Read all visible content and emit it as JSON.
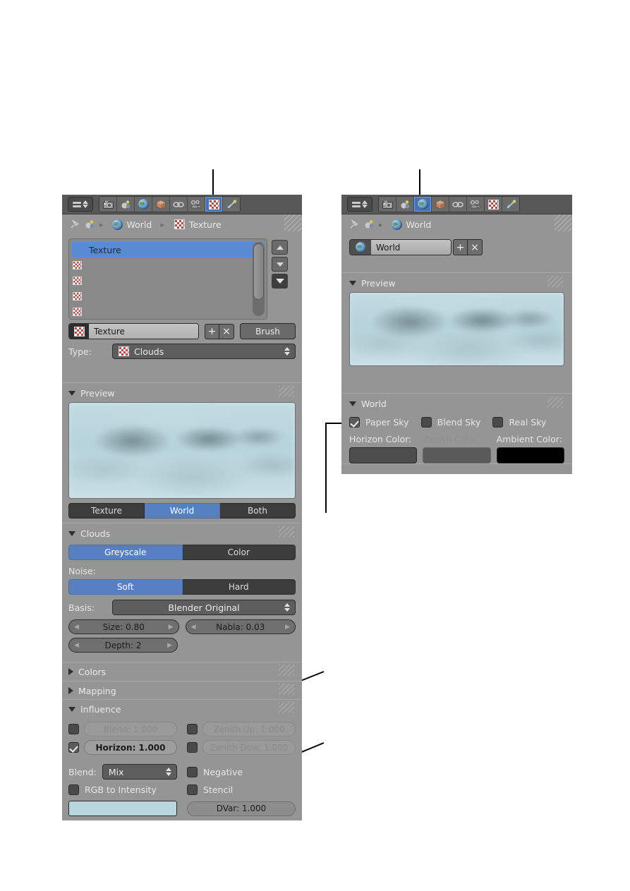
{
  "left_panel": {
    "header": {
      "editor_selector": "editor-type-selector",
      "tabs": [
        {
          "name": "render",
          "icon": "camera-icon",
          "active": false
        },
        {
          "name": "scene",
          "icon": "scene-icon",
          "active": false
        },
        {
          "name": "world",
          "icon": "globe-icon",
          "active": false
        },
        {
          "name": "object",
          "icon": "cube-icon",
          "active": false
        },
        {
          "name": "constraints",
          "icon": "chain-link-icon",
          "active": false
        },
        {
          "name": "physics",
          "icon": "physics-icon",
          "active": false
        },
        {
          "name": "texture",
          "icon": "checker-icon",
          "active": true
        },
        {
          "name": "particles",
          "icon": "particles-icon",
          "active": false
        }
      ]
    },
    "breadcrumb": {
      "pin": "pin-icon",
      "root_icon": "scene-icon",
      "items": [
        "World",
        "Texture"
      ],
      "sep": "▸"
    },
    "texture_list": {
      "selected": "Texture",
      "rows": [
        "Texture",
        "",
        "",
        "",
        ""
      ]
    },
    "name_row": {
      "icon": "checker-icon",
      "value": "Texture",
      "add_label": "+",
      "remove_label": "×",
      "brush_label": "Brush"
    },
    "type_row": {
      "label": "Type:",
      "value": "Clouds"
    },
    "preview": {
      "title": "Preview",
      "modes": [
        "Texture",
        "World",
        "Both"
      ],
      "active_mode": "World"
    },
    "clouds": {
      "title": "Clouds",
      "color_modes": [
        "Greyscale",
        "Color"
      ],
      "active_color_mode": "Greyscale",
      "noise_label": "Noise:",
      "noise_modes": [
        "Soft",
        "Hard"
      ],
      "active_noise_mode": "Soft",
      "basis_label": "Basis:",
      "basis_value": "Blender Original",
      "size": "Size: 0.80",
      "nabla": "Nabla: 0.03",
      "depth": "Depth: 2"
    },
    "colors_section": {
      "title": "Colors",
      "expanded": false
    },
    "mapping_section": {
      "title": "Mapping",
      "expanded": false
    },
    "influence": {
      "title": "Influence",
      "rows": [
        {
          "label": "Blend: 1.000",
          "checked": false,
          "enabled": false
        },
        {
          "label": "Zenith Up: 1.000",
          "checked": false,
          "enabled": false
        },
        {
          "label": "Horizon: 1.000",
          "checked": true,
          "enabled": true
        },
        {
          "label": "Zenith Dow: 1.000",
          "checked": false,
          "enabled": false
        }
      ],
      "blend_label": "Blend:",
      "blend_value": "Mix",
      "negative_label": "Negative",
      "negative_checked": false,
      "rgb_to_intensity_label": "RGB to Intensity",
      "rgb_to_intensity_checked": false,
      "stencil_label": "Stencil",
      "stencil_checked": false,
      "color_swatch": "#b9d6de",
      "dvar_label": "DVar: 1.000"
    }
  },
  "right_panel": {
    "header": {
      "tabs": [
        {
          "name": "render",
          "icon": "camera-icon",
          "active": false
        },
        {
          "name": "scene",
          "icon": "scene-icon",
          "active": false
        },
        {
          "name": "world",
          "icon": "globe-icon",
          "active": true
        },
        {
          "name": "object",
          "icon": "cube-icon",
          "active": false
        },
        {
          "name": "constraints",
          "icon": "chain-link-icon",
          "active": false
        },
        {
          "name": "physics",
          "icon": "physics-icon",
          "active": false
        },
        {
          "name": "texture",
          "icon": "checker-icon",
          "active": false
        },
        {
          "name": "particles",
          "icon": "particles-icon",
          "active": false
        }
      ]
    },
    "breadcrumb": {
      "pin": "pin-icon",
      "root_icon": "scene-icon",
      "items": [
        "World"
      ],
      "sep": "▸"
    },
    "world_datablock": {
      "icon": "globe-icon",
      "value": "World",
      "add_label": "+",
      "remove_label": "×"
    },
    "preview": {
      "title": "Preview"
    },
    "world_section": {
      "title": "World",
      "checkboxes": [
        {
          "label": "Paper Sky",
          "checked": true
        },
        {
          "label": "Blend Sky",
          "checked": false
        },
        {
          "label": "Real Sky",
          "checked": false
        }
      ],
      "colors": [
        {
          "label": "Horizon Color:",
          "value": "#4d4d4d",
          "enabled": true
        },
        {
          "label": "Zenith Color:",
          "value": "#5a5a5a",
          "enabled": false
        },
        {
          "label": "Ambient Color:",
          "value": "#000000",
          "enabled": true
        }
      ]
    }
  },
  "callouts": [
    {
      "name": "callout-texture-tab"
    },
    {
      "name": "callout-world-tab"
    },
    {
      "name": "callout-paper-sky"
    },
    {
      "name": "callout-horizon-influence"
    },
    {
      "name": "callout-influence-color"
    }
  ],
  "theme": {
    "panel_bg": "#959595",
    "header_bg": "#585858",
    "accent_blue": "#5680c2",
    "button_dark": "#3d3d3d",
    "text": "#e6e6e6"
  }
}
